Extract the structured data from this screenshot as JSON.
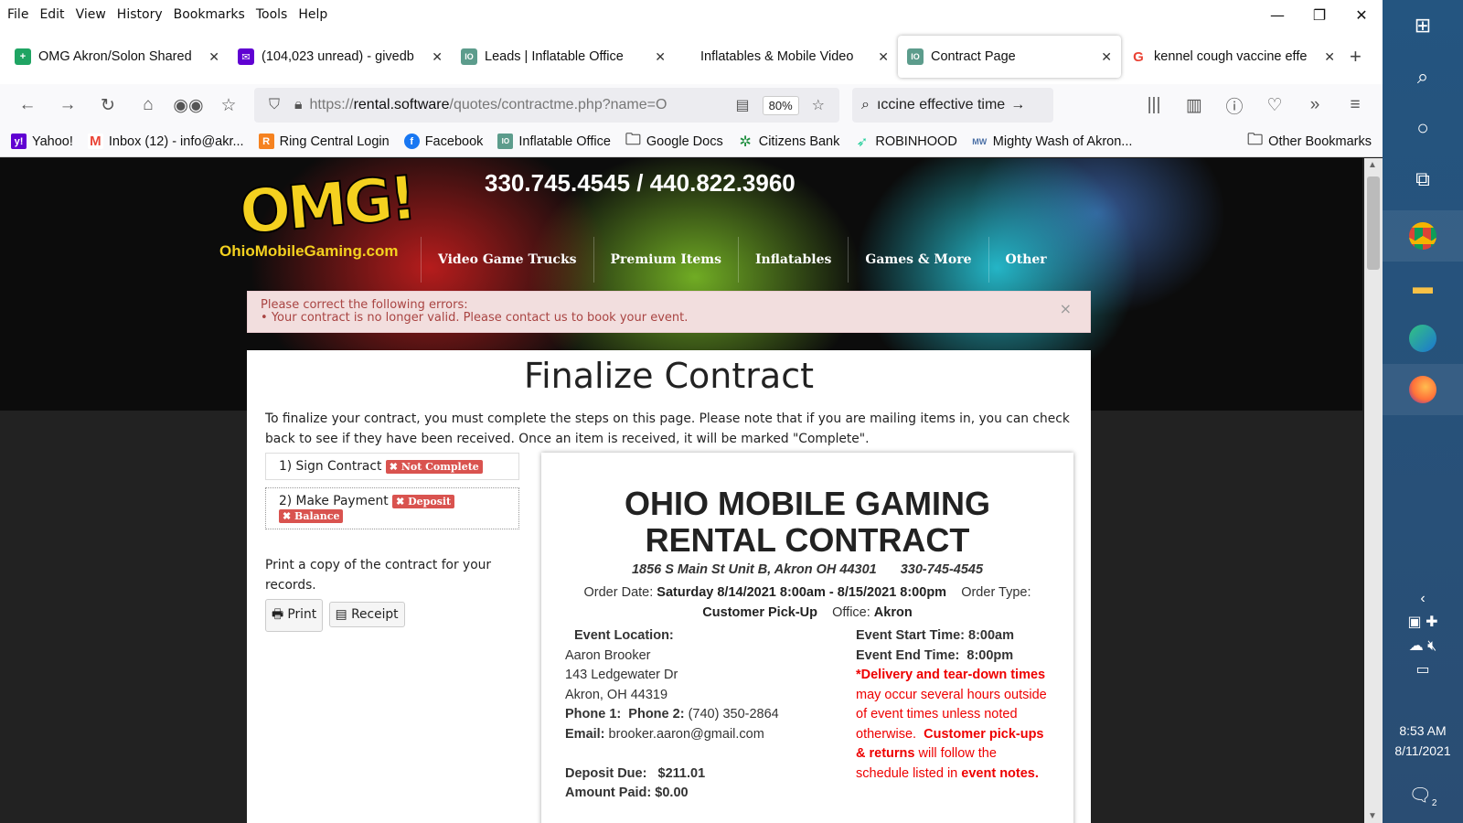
{
  "menubar": {
    "items": [
      "File",
      "Edit",
      "View",
      "History",
      "Bookmarks",
      "Tools",
      "Help"
    ]
  },
  "window_controls": {
    "minimize": "—",
    "restore": "❐",
    "close": "✕"
  },
  "tabs": [
    {
      "label": "OMG Akron/Solon Shared",
      "icon": "sheets-icon",
      "color": "#1fa463",
      "glyph": "+"
    },
    {
      "label": "(104,023 unread) - givedb",
      "icon": "mail-icon",
      "color": "#6001d2",
      "glyph": "✉"
    },
    {
      "label": "Leads | Inflatable Office",
      "icon": "io-icon",
      "color": "#5c9c8c",
      "glyph": "IO"
    },
    {
      "label": "Inflatables & Mobile Video",
      "icon": "",
      "color": "",
      "glyph": ""
    },
    {
      "label": "Contract Page",
      "icon": "io-icon",
      "color": "#5c9c8c",
      "glyph": "IO",
      "active": true
    },
    {
      "label": "kennel cough vaccine effe",
      "icon": "google-icon",
      "color": "#ea4335",
      "glyph": "G"
    }
  ],
  "nav": {
    "url_prefix": "https://",
    "url_host": "rental.software",
    "url_rest": "/quotes/contractme.php?name=O",
    "zoom": "80%",
    "search_text": "ıccine effective time"
  },
  "bookmarks": [
    {
      "label": "Yahoo!",
      "color": "#6001d2",
      "glyph": "y!"
    },
    {
      "label": "Inbox (12) - info@akr...",
      "color": "#ea4335",
      "glyph": "M"
    },
    {
      "label": "Ring Central Login",
      "color": "#f58220",
      "glyph": "R"
    },
    {
      "label": "Facebook",
      "color": "#1877f2",
      "glyph": "f"
    },
    {
      "label": "Inflatable Office",
      "color": "#5c9c8c",
      "glyph": "IO"
    },
    {
      "label": "Google Docs",
      "color": "",
      "glyph": "🗀"
    },
    {
      "label": "Citizens Bank",
      "color": "#1e8e3e",
      "glyph": "✲"
    },
    {
      "label": "ROBINHOOD",
      "color": "#21ce99",
      "glyph": "➶"
    },
    {
      "label": "Mighty Wash of Akron...",
      "color": "#4a6fa5",
      "glyph": "MW"
    }
  ],
  "other_bookmarks": "Other Bookmarks",
  "site": {
    "phone": "330.745.4545 / 440.822.3960",
    "logo_text": "OMG!",
    "logo_site": "OhioMobileGaming.com",
    "nav": [
      "Video Game Trucks",
      "Premium Items",
      "Inflatables",
      "Games & More",
      "Other"
    ]
  },
  "alert": {
    "heading": "Please correct the following errors:",
    "message": "Your contract is no longer valid. Please contact us to book your event.",
    "close": "×"
  },
  "page": {
    "title": "Finalize Contract",
    "intro": "To finalize your contract, you must complete the steps on this page. Please note that if you are mailing items in, you can check back to see if they have been received. Once an item is received, it will be marked \"Complete\".",
    "step1": "1) Sign Contract",
    "step1_badge": "✖ Not Complete",
    "step2": "2) Make Payment",
    "step2_badge1": "✖ Deposit",
    "step2_badge2": "✖ Balance",
    "print_note": "Print a copy of the contract for your records.",
    "print_btn": "Print",
    "receipt_btn": "Receipt"
  },
  "contract": {
    "title_line1": "OHIO MOBILE GAMING",
    "title_line2": "RENTAL CONTRACT",
    "address": "1856 S Main St Unit B, Akron OH 44301",
    "phone": "330-745-4545",
    "order_date_label": "Order Date:",
    "order_date": "Saturday 8/14/2021 8:00am - 8/15/2021 8:00pm",
    "order_type_label": "Order Type:",
    "order_type": "Customer Pick-Up",
    "office_label": "Office:",
    "office": "Akron",
    "event_location_label": "Event Location:",
    "name": "Aaron Brooker",
    "street": "143 Ledgewater Dr",
    "city": "Akron, OH 44319",
    "phone1_label": "Phone 1:",
    "phone2_label": "Phone 2:",
    "phone2": "(740) 350-2864",
    "email_label": "Email:",
    "email": "brooker.aaron@gmail.com",
    "deposit_label": "Deposit Due:",
    "deposit": "$211.01",
    "paid_label": "Amount Paid:",
    "paid": "$0.00",
    "start_label": "Event Start Time:",
    "start": "8:00am",
    "end_label": "Event End Time:",
    "end": "8:00pm",
    "note_bold1": "*Delivery and tear-down times",
    "note_text1": "may occur several hours outside of event times unless noted otherwise.",
    "note_bold2": "Customer pick-ups & returns",
    "note_text2": "will follow the schedule listed in",
    "note_bold3": "event notes."
  },
  "taskbar": {
    "time": "8:53 AM",
    "date": "8/11/2021",
    "notifications": "2"
  }
}
